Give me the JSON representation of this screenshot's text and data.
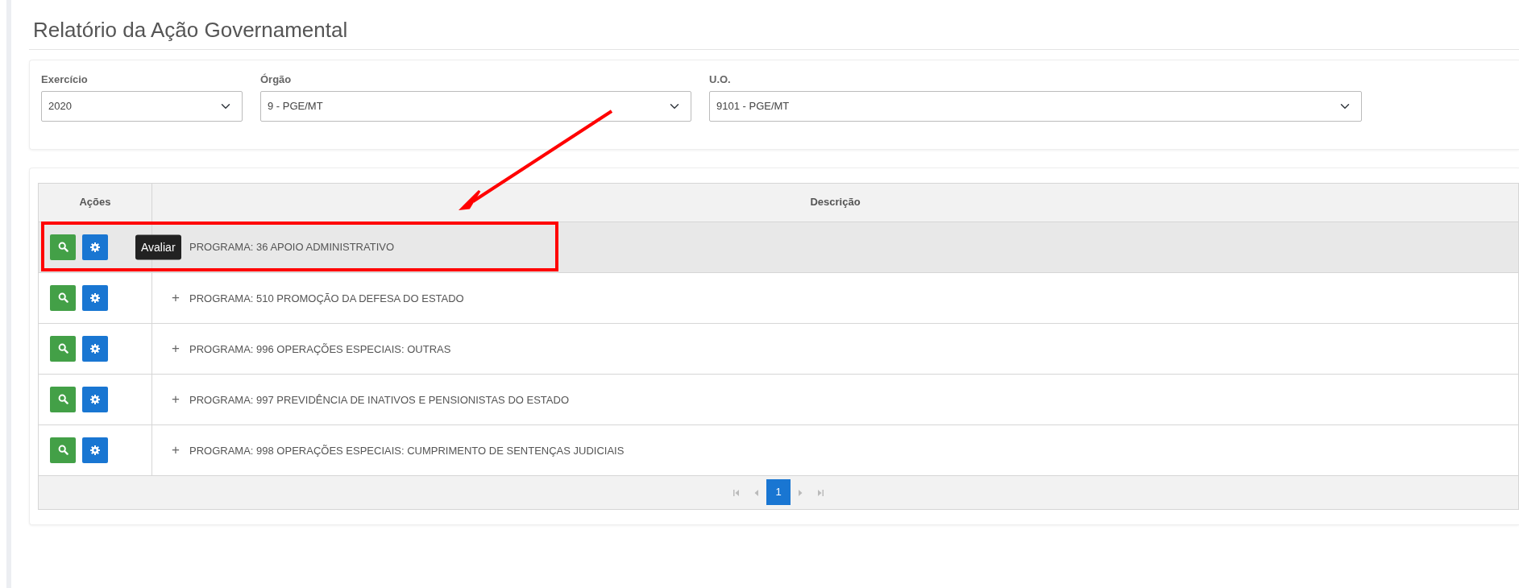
{
  "page": {
    "title": "Relatório da Ação Governamental"
  },
  "filters": [
    {
      "label": "Exercício",
      "value": "2020"
    },
    {
      "label": "Órgão",
      "value": "9 - PGE/MT"
    },
    {
      "label": "U.O.",
      "value": "9101 - PGE/MT"
    }
  ],
  "table": {
    "columns": [
      "Ações",
      "Descrição"
    ],
    "rows": [
      {
        "description": "PROGRAMA: 36 APOIO ADMINISTRATIVO",
        "expander": "",
        "highlighted": true,
        "tooltip": "Avaliar"
      },
      {
        "description": "PROGRAMA: 510 PROMOÇÃO DA DEFESA DO ESTADO",
        "expander": "+",
        "highlighted": false
      },
      {
        "description": "PROGRAMA: 996 OPERAÇÕES ESPECIAIS: OUTRAS",
        "expander": "+",
        "highlighted": false
      },
      {
        "description": "PROGRAMA: 997 PREVIDÊNCIA DE INATIVOS E PENSIONISTAS DO ESTADO",
        "expander": "+",
        "highlighted": false
      },
      {
        "description": "PROGRAMA: 998 OPERAÇÕES ESPECIAIS: CUMPRIMENTO DE SENTENÇAS JUDICIAIS",
        "expander": "+",
        "highlighted": false
      }
    ]
  },
  "pagination": {
    "pages": [
      {
        "label": "1",
        "selected": true
      }
    ]
  }
}
